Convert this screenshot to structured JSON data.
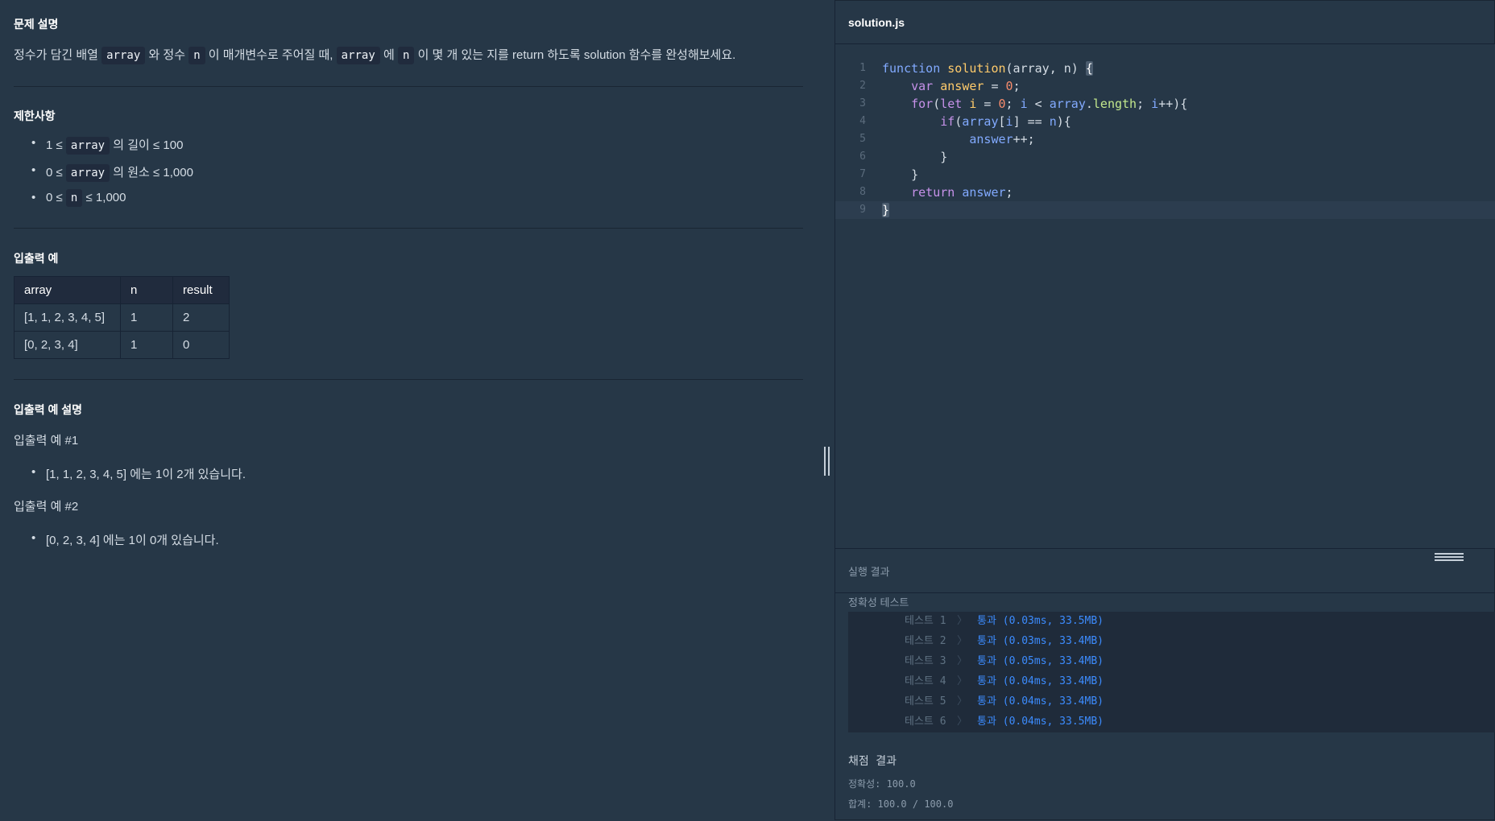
{
  "problem": {
    "desc_title": "문제 설명",
    "desc": {
      "p1": "정수가 담긴 배열",
      "c1": "array",
      "p2": "와 정수",
      "c2": "n",
      "p3": "이 매개변수로 주어질 때,",
      "c3": "array",
      "p4": "에",
      "c4": "n",
      "p5": "이 몇 개 있는 지를 return 하도록 solution 함수를 완성해보세요."
    },
    "constraints_title": "제한사항",
    "constraints": [
      {
        "pre": "1 ≤",
        "code": "array",
        "post": "의 길이 ≤ 100"
      },
      {
        "pre": "0 ≤",
        "code": "array",
        "post": "의 원소 ≤ 1,000"
      },
      {
        "pre": "0 ≤",
        "code": "n",
        "post": "≤ 1,000"
      }
    ],
    "io_title": "입출력 예",
    "io_table": {
      "headers": [
        "array",
        "n",
        "result"
      ],
      "rows": [
        [
          "[1, 1, 2, 3, 4, 5]",
          "1",
          "2"
        ],
        [
          "[0, 2, 3, 4]",
          "1",
          "0"
        ]
      ]
    },
    "io_explain_title": "입출력 예 설명",
    "examples": [
      {
        "label": "입출력 예 #1",
        "bullet": "[1, 1, 2, 3, 4, 5] 에는 1이 2개 있습니다."
      },
      {
        "label": "입출력 예 #2",
        "bullet": "[0, 2, 3, 4] 에는 1이 0개 있습니다."
      }
    ]
  },
  "editor": {
    "file_name": "solution.js",
    "line_numbers": [
      "1",
      "2",
      "3",
      "4",
      "5",
      "6",
      "7",
      "8",
      "9"
    ]
  },
  "results": {
    "title": "실행 결과",
    "subtitle": "정확성  테스트",
    "separator": "〉",
    "tests": [
      {
        "label": "테스트 1",
        "result": "통과 (0.03ms, 33.5MB)"
      },
      {
        "label": "테스트 2",
        "result": "통과 (0.03ms, 33.4MB)"
      },
      {
        "label": "테스트 3",
        "result": "통과 (0.05ms, 33.4MB)"
      },
      {
        "label": "테스트 4",
        "result": "통과 (0.04ms, 33.4MB)"
      },
      {
        "label": "테스트 5",
        "result": "통과 (0.04ms, 33.4MB)"
      },
      {
        "label": "테스트 6",
        "result": "통과 (0.04ms, 33.5MB)"
      }
    ],
    "score_title": "채점 결과",
    "accuracy": "정확성: 100.0",
    "total": "합계: 100.0 / 100.0"
  },
  "colors": {
    "background": "#263747",
    "code_bg": "#202b3d",
    "pass": "#3c8cff"
  }
}
